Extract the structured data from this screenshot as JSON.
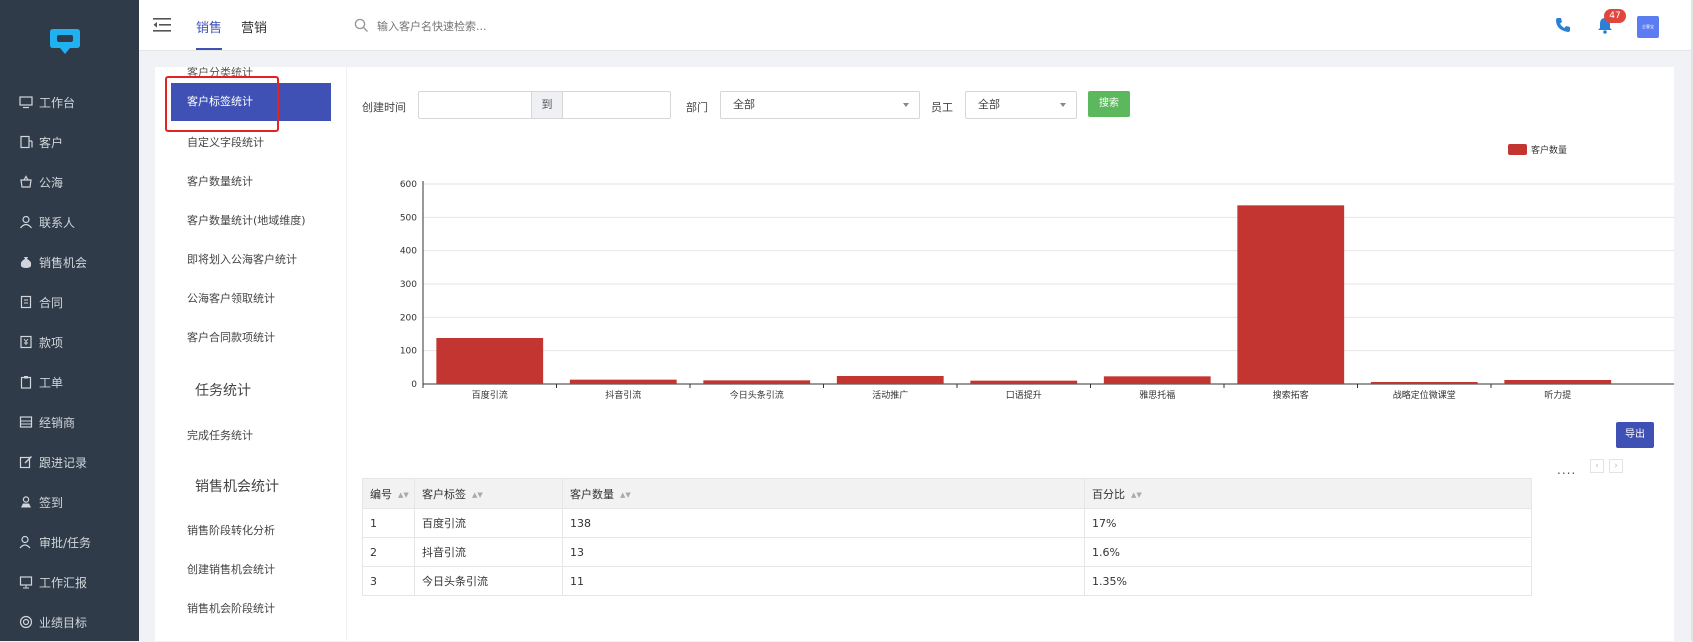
{
  "nav": {
    "items": [
      {
        "icon": "monitor-icon",
        "label": "工作台"
      },
      {
        "icon": "building-icon",
        "label": "客户"
      },
      {
        "icon": "basket-icon",
        "label": "公海"
      },
      {
        "icon": "person-icon",
        "label": "联系人"
      },
      {
        "icon": "moneybag-icon",
        "label": "销售机会"
      },
      {
        "icon": "document-icon",
        "label": "合同"
      },
      {
        "icon": "payment-icon",
        "label": "款项"
      },
      {
        "icon": "clipboard-icon",
        "label": "工单"
      },
      {
        "icon": "dealer-icon",
        "label": "经销商"
      },
      {
        "icon": "edit-icon",
        "label": "跟进记录"
      },
      {
        "icon": "location-icon",
        "label": "签到"
      },
      {
        "icon": "approval-icon",
        "label": "审批/任务"
      },
      {
        "icon": "report-icon",
        "label": "工作汇报"
      },
      {
        "icon": "target-icon",
        "label": "业绩目标"
      }
    ]
  },
  "header": {
    "tabs": [
      "销售",
      "营销"
    ],
    "search_placeholder": "输入客户名快速检索...",
    "notification_count": "47",
    "avatar_text": "企客宝"
  },
  "submenu": {
    "clipped_item": "客户分类统计",
    "active_item": "客户标签统计",
    "items": [
      "自定义字段统计",
      "客户数量统计",
      "客户数量统计(地域维度)",
      "即将划入公海客户统计",
      "公海客户领取统计",
      "客户合同款项统计"
    ],
    "task_heading": "任务统计",
    "task_items": [
      "完成任务统计"
    ],
    "opportunity_heading": "销售机会统计",
    "opportunity_items": [
      "销售阶段转化分析",
      "创建销售机会统计",
      "销售机会阶段统计"
    ]
  },
  "filters": {
    "created_label": "创建时间",
    "to_label": "到",
    "dept_label": "部门",
    "dept_value": "全部",
    "staff_label": "员工",
    "staff_value": "全部",
    "search_button": "搜索"
  },
  "chart_data": {
    "type": "bar",
    "categories": [
      "百度引流",
      "抖音引流",
      "今日头条引流",
      "活动推广",
      "口语提升",
      "雅思托福",
      "搜索拓客",
      "战略定位微课堂",
      "听力提"
    ],
    "series": [
      {
        "name": "客户数量",
        "values": [
          138,
          13,
          11,
          24,
          10,
          23,
          536,
          6,
          12
        ]
      }
    ],
    "ylim": [
      0,
      600
    ],
    "yticks": [
      "0",
      "100",
      "200",
      "300",
      "400",
      "500",
      "600"
    ],
    "legend_position": "top-right",
    "color": "#c23531",
    "grid": true
  },
  "export_button": "导出",
  "pager": {
    "dots": "....",
    "prev": "‹",
    "next": "›"
  },
  "table": {
    "headers": [
      "编号",
      "客户标签",
      "客户数量",
      "百分比"
    ],
    "rows": [
      [
        "1",
        "百度引流",
        "138",
        "17%"
      ],
      [
        "2",
        "抖音引流",
        "13",
        "1.6%"
      ],
      [
        "3",
        "今日头条引流",
        "11",
        "1.35%"
      ]
    ]
  }
}
